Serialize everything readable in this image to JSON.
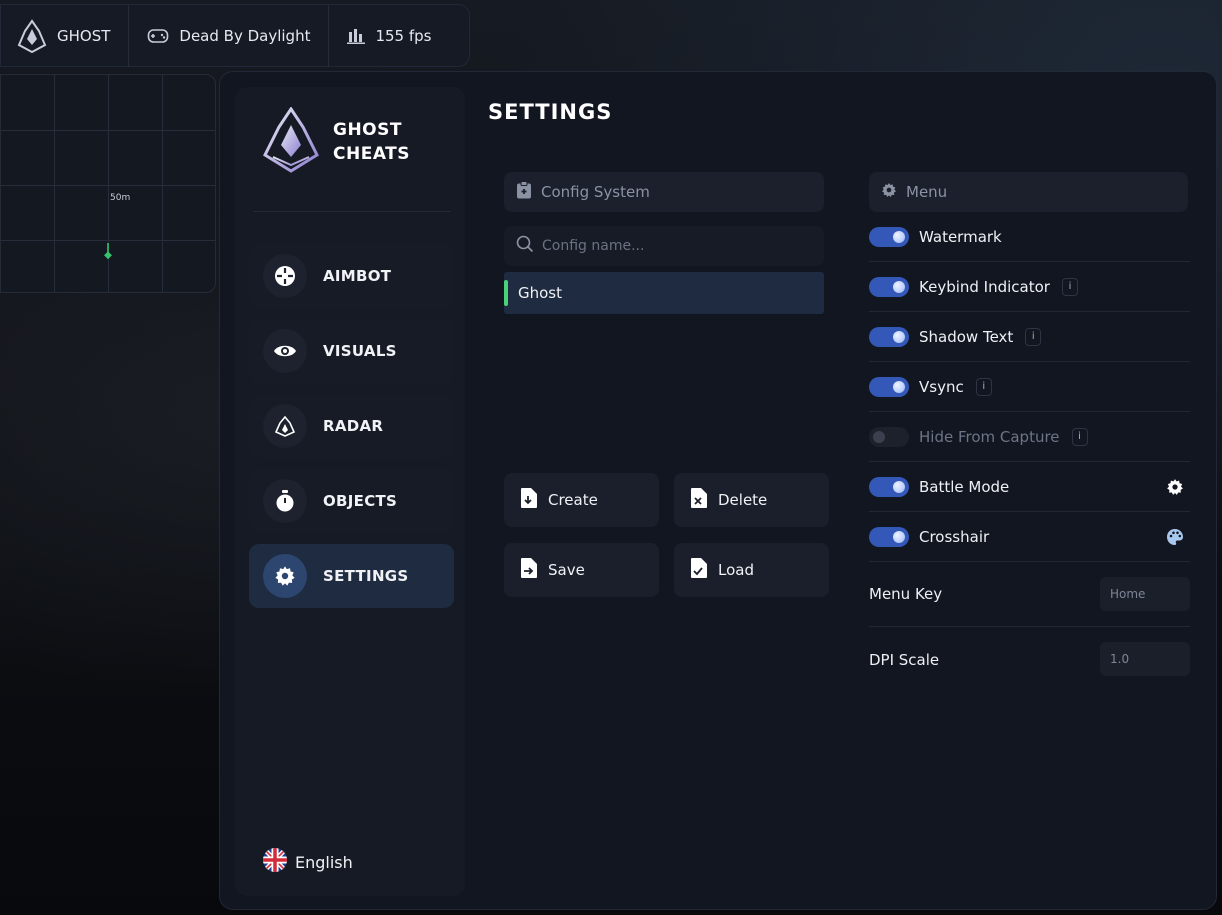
{
  "topbar": {
    "brand": "GHOST",
    "game": "Dead By Daylight",
    "fps": "155 fps"
  },
  "radar": {
    "distance_label": "50m"
  },
  "logo": {
    "line1": "GHOST",
    "line2": "CHEATS"
  },
  "nav": {
    "items": [
      {
        "label": "AIMBOT",
        "icon": "crosshair-icon"
      },
      {
        "label": "VISUALS",
        "icon": "eye-icon"
      },
      {
        "label": "RADAR",
        "icon": "radar-icon"
      },
      {
        "label": "OBJECTS",
        "icon": "stopwatch-icon"
      },
      {
        "label": "SETTINGS",
        "icon": "gear-icon",
        "active": true
      }
    ]
  },
  "language": "English",
  "page_title": "SETTINGS",
  "config": {
    "header": "Config System",
    "search_placeholder": "Config name...",
    "items": [
      "Ghost"
    ],
    "buttons": {
      "create": "Create",
      "delete": "Delete",
      "save": "Save",
      "load": "Load"
    }
  },
  "menu": {
    "header": "Menu",
    "toggles": [
      {
        "label": "Watermark",
        "on": true,
        "info": false
      },
      {
        "label": "Keybind Indicator",
        "on": true,
        "info": true
      },
      {
        "label": "Shadow Text",
        "on": true,
        "info": true
      },
      {
        "label": "Vsync",
        "on": true,
        "info": true
      },
      {
        "label": "Hide From Capture",
        "on": false,
        "info": true
      },
      {
        "label": "Battle Mode",
        "on": true,
        "info": false,
        "extra_icon": "gear-icon"
      },
      {
        "label": "Crosshair",
        "on": true,
        "info": false,
        "extra_icon": "palette-icon"
      }
    ],
    "info_label": "i",
    "menu_key_label": "Menu Key",
    "menu_key_value": "Home",
    "dpi_scale_label": "DPI Scale",
    "dpi_scale_value": "1.0"
  },
  "colors": {
    "accent": "#3358b8",
    "active_nav": "#2d4670",
    "config_selected_bar": "#4ad27a"
  }
}
